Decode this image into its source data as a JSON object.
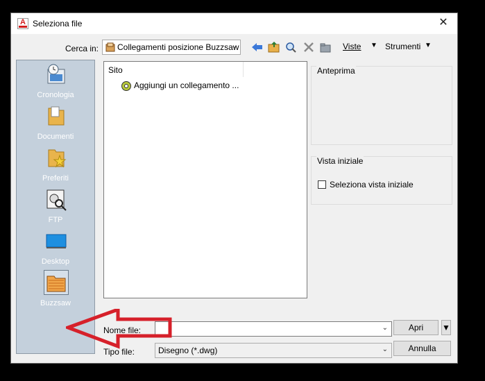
{
  "window": {
    "title": "Seleziona file",
    "close_glyph": "✕"
  },
  "look_in": {
    "label": "Cerca in:",
    "value": "Collegamenti posizione Buzzsaw"
  },
  "toolbar": {
    "icons": [
      "back-icon",
      "up-folder-icon",
      "search-web-icon",
      "delete-icon",
      "new-folder-icon"
    ],
    "views_label": "Viste",
    "tools_label": "Strumenti"
  },
  "places": [
    {
      "label": "Cronologia",
      "icon": "history-icon"
    },
    {
      "label": "Documenti",
      "icon": "documents-folder-icon"
    },
    {
      "label": "Preferiti",
      "icon": "favorites-folder-icon"
    },
    {
      "label": "FTP",
      "icon": "ftp-icon"
    },
    {
      "label": "Desktop",
      "icon": "desktop-icon"
    },
    {
      "label": "Buzzsaw",
      "icon": "buzzsaw-folder-icon",
      "selected": true
    }
  ],
  "file_list": {
    "column_header": "Sito",
    "items": [
      {
        "label": "Aggiungi un collegamento ...",
        "icon": "add-link-icon"
      }
    ]
  },
  "preview": {
    "title": "Anteprima"
  },
  "initial_view": {
    "title": "Vista iniziale",
    "checkbox_label": "Seleziona vista iniziale",
    "checked": false
  },
  "file_name": {
    "label": "Nome file:",
    "value": ""
  },
  "file_type": {
    "label": "Tipo file:",
    "value": "Disegno (*.dwg)"
  },
  "buttons": {
    "open": "Apri",
    "cancel": "Annulla"
  },
  "colors": {
    "places_bg": "#c4d0dc",
    "annotation_arrow": "#d6202a"
  }
}
